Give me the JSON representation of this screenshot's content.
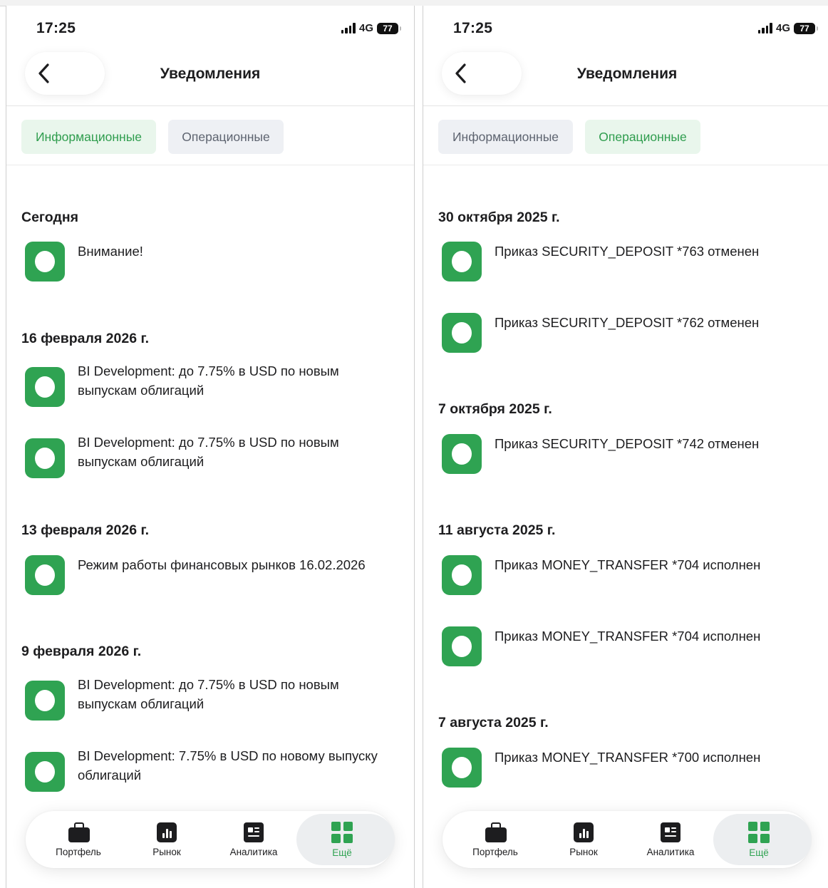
{
  "screens": [
    {
      "status_time": "17:25",
      "network": "4G",
      "battery": "77",
      "title": "Уведомления",
      "tabs": [
        {
          "label": "Информационные",
          "active": true
        },
        {
          "label": "Операционные",
          "active": false
        }
      ],
      "groups": [
        {
          "date": "Сегодня",
          "items": [
            "Внимание!"
          ]
        },
        {
          "date": "16 февраля 2026 г.",
          "items": [
            "BI Development: до 7.75% в USD по новым выпускам облигаций",
            "BI Development: до 7.75% в USD по новым выпускам облигаций"
          ]
        },
        {
          "date": "13 февраля 2026 г.",
          "items": [
            "Режим работы финансовых рынков 16.02.2026"
          ]
        },
        {
          "date": "9 февраля 2026 г.",
          "items": [
            "BI Development: до 7.75% в USD по новым выпускам облигаций",
            "BI Development: 7.75% в USD по новому выпуску облигаций"
          ]
        }
      ],
      "nav": [
        {
          "label": "Портфель",
          "icon": "briefcase-icon",
          "active": false
        },
        {
          "label": "Рынок",
          "icon": "chart-icon",
          "active": false
        },
        {
          "label": "Аналитика",
          "icon": "news-icon",
          "active": false
        },
        {
          "label": "Ещё",
          "icon": "grid-icon",
          "active": true
        }
      ]
    },
    {
      "status_time": "17:25",
      "network": "4G",
      "battery": "77",
      "title": "Уведомления",
      "tabs": [
        {
          "label": "Информационные",
          "active": false
        },
        {
          "label": "Операционные",
          "active": true
        }
      ],
      "groups": [
        {
          "date": "30 октября 2025 г.",
          "items": [
            "Приказ SECURITY_DEPOSIT *763 отменен",
            "Приказ SECURITY_DEPOSIT *762 отменен"
          ]
        },
        {
          "date": "7 октября 2025 г.",
          "items": [
            "Приказ SECURITY_DEPOSIT *742 отменен"
          ]
        },
        {
          "date": "11 августа 2025 г.",
          "items": [
            "Приказ MONEY_TRANSFER *704 исполнен",
            "Приказ MONEY_TRANSFER *704 исполнен"
          ]
        },
        {
          "date": "7 августа 2025 г.",
          "items": [
            "Приказ MONEY_TRANSFER *700 исполнен"
          ]
        }
      ],
      "nav": [
        {
          "label": "Портфель",
          "icon": "briefcase-icon",
          "active": false
        },
        {
          "label": "Рынок",
          "icon": "chart-icon",
          "active": false
        },
        {
          "label": "Аналитика",
          "icon": "news-icon",
          "active": false
        },
        {
          "label": "Ещё",
          "icon": "grid-icon",
          "active": true
        }
      ]
    }
  ],
  "colors": {
    "accent": "#2fa352",
    "tab_active_bg": "#e9f6ec",
    "tab_inactive_bg": "#eef0f4",
    "text": "#1d1d1f"
  }
}
